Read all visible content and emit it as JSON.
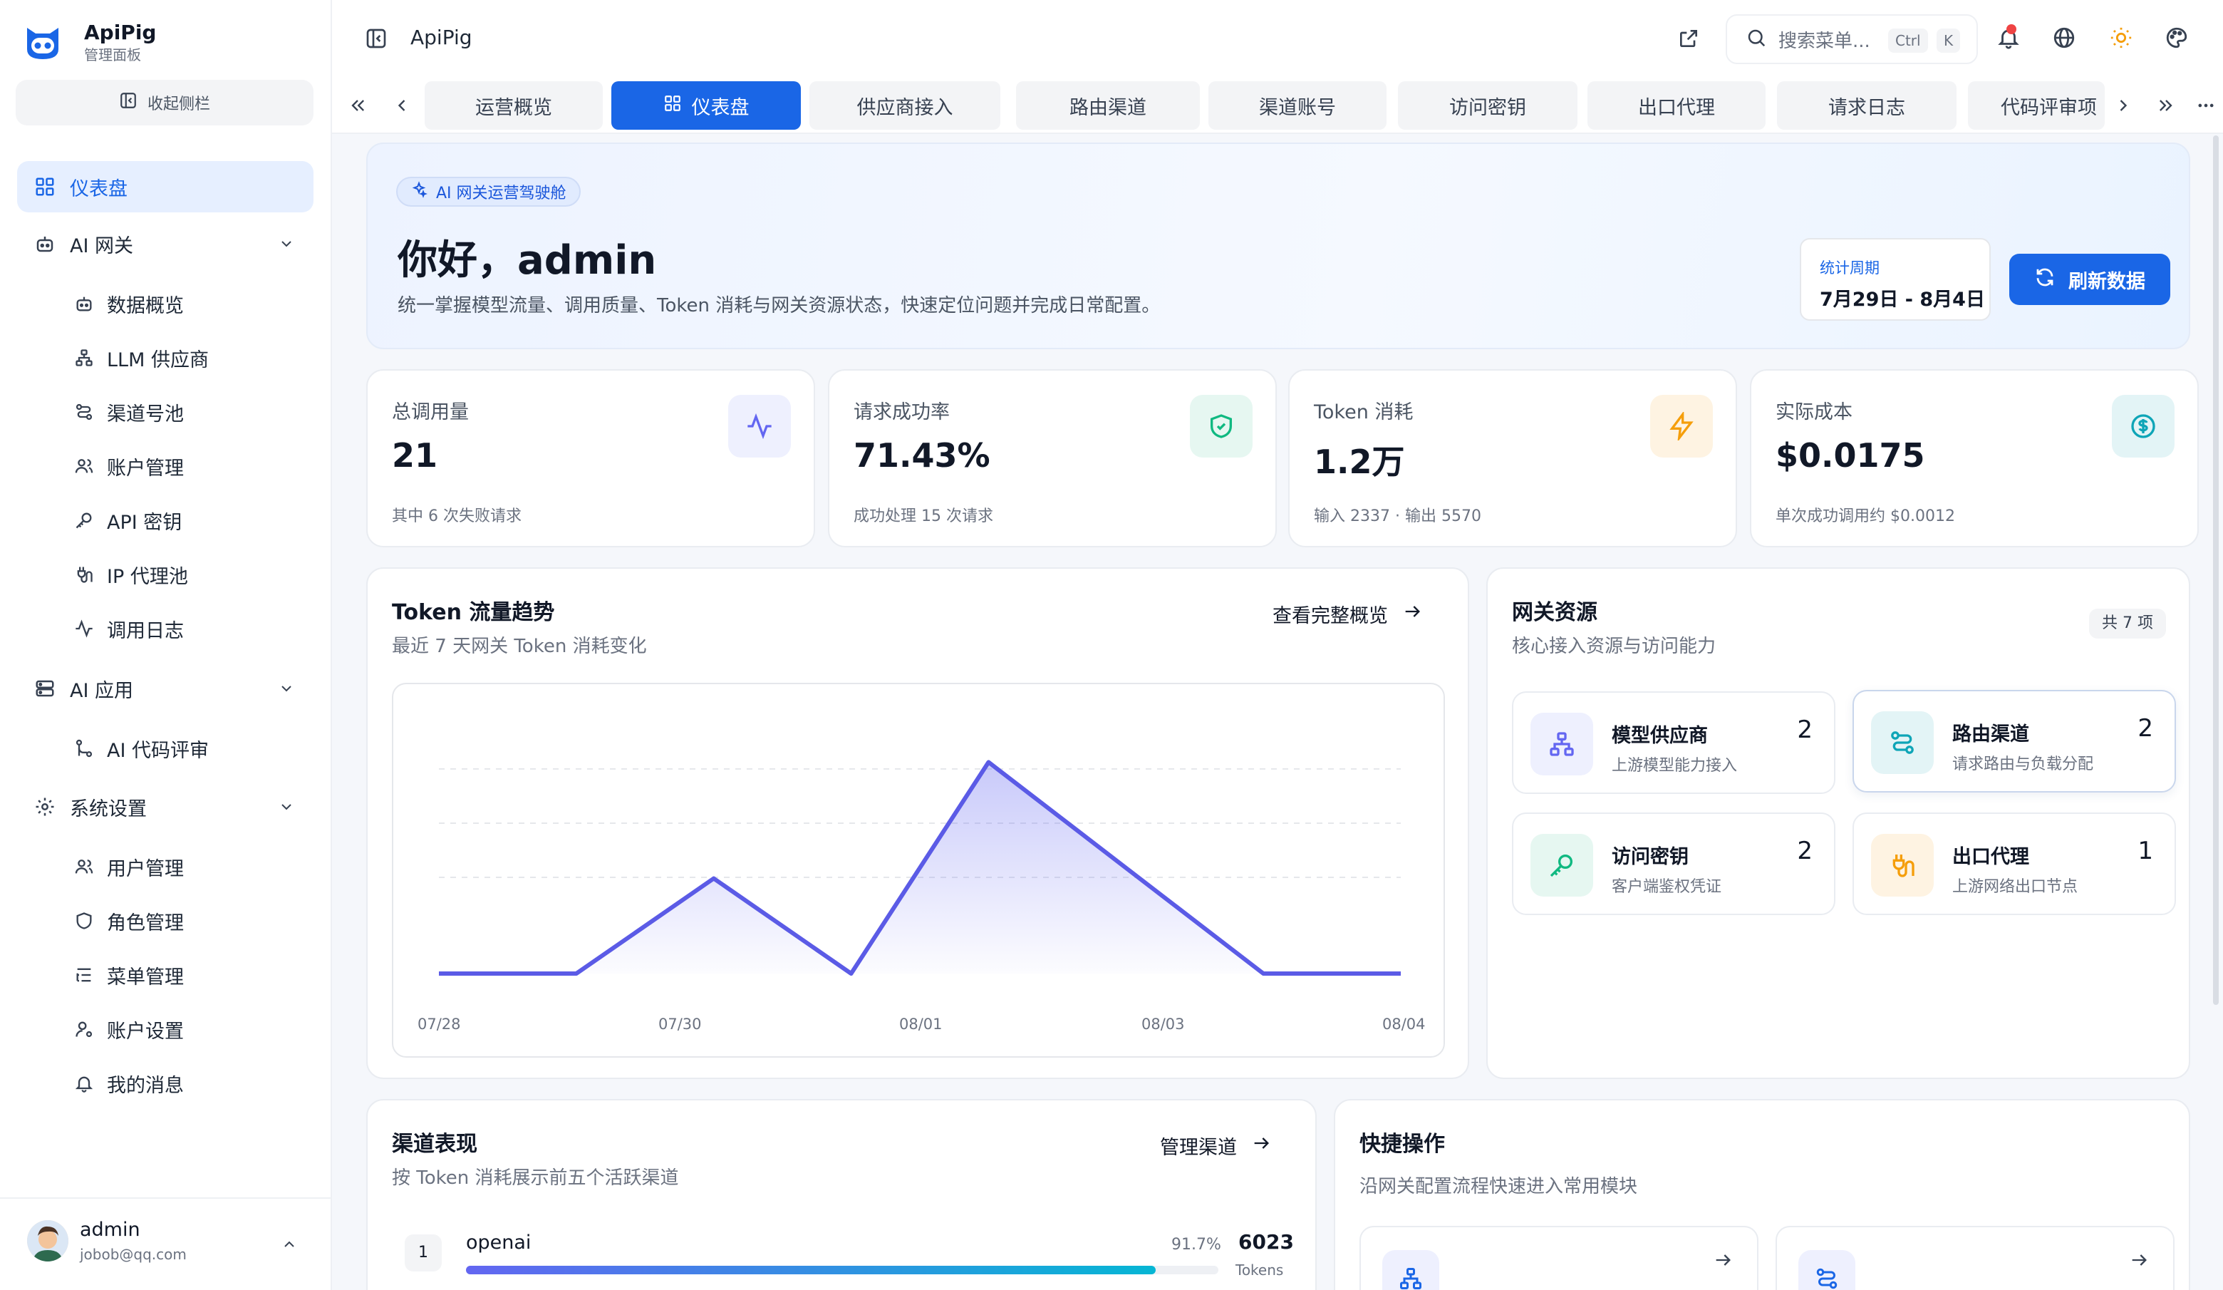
{
  "brand": {
    "name": "ApiPig",
    "subtitle": "管理面板"
  },
  "sidebar": {
    "collapse_label": "收起侧栏",
    "items": [
      {
        "label": "仪表盘",
        "icon": "dashboard-icon",
        "active": true
      },
      {
        "label": "AI 网关",
        "icon": "robot-icon",
        "group": true
      },
      {
        "label": "数据概览",
        "icon": "robot-icon"
      },
      {
        "label": "LLM 供应商",
        "icon": "network-icon"
      },
      {
        "label": "渠道号池",
        "icon": "route-icon"
      },
      {
        "label": "账户管理",
        "icon": "users-icon"
      },
      {
        "label": "API 密钥",
        "icon": "key-icon"
      },
      {
        "label": "IP 代理池",
        "icon": "plug-icon"
      },
      {
        "label": "调用日志",
        "icon": "activity-icon"
      },
      {
        "label": "AI 应用",
        "icon": "server-icon",
        "group": true
      },
      {
        "label": "AI 代码评审",
        "icon": "git-icon"
      },
      {
        "label": "系统设置",
        "icon": "gear-icon",
        "group": true
      },
      {
        "label": "用户管理",
        "icon": "users-icon"
      },
      {
        "label": "角色管理",
        "icon": "shield-icon"
      },
      {
        "label": "菜单管理",
        "icon": "list-icon"
      },
      {
        "label": "账户设置",
        "icon": "user-gear-icon"
      },
      {
        "label": "我的消息",
        "icon": "bell-icon"
      }
    ]
  },
  "user": {
    "name": "admin",
    "email": "jobob@qq.com"
  },
  "topbar": {
    "title": "ApiPig",
    "search_placeholder": "搜索菜单...",
    "kbd_ctrl": "Ctrl",
    "kbd_k": "K"
  },
  "tabs": [
    {
      "label": "运营概览",
      "active": false
    },
    {
      "label": "仪表盘",
      "active": true
    },
    {
      "label": "供应商接入",
      "active": false
    },
    {
      "label": "路由渠道",
      "active": false
    },
    {
      "label": "渠道账号",
      "active": false
    },
    {
      "label": "访问密钥",
      "active": false
    },
    {
      "label": "出口代理",
      "active": false
    },
    {
      "label": "请求日志",
      "active": false
    },
    {
      "label": "代码评审项",
      "active": false
    }
  ],
  "hero": {
    "badge": "AI 网关运营驾驶舱",
    "title": "你好，admin",
    "desc": "统一掌握模型流量、调用质量、Token 消耗与网关资源状态，快速定位问题并完成日常配置。",
    "period_label": "统计周期",
    "period_value": "7月29日 - 8月4日",
    "refresh_label": "刷新数据"
  },
  "stats": [
    {
      "label": "总调用量",
      "value": "21",
      "sub": "其中 6 次失败请求",
      "icon": "activity-icon",
      "color": "#6366f1",
      "bg": "#eef0fe"
    },
    {
      "label": "请求成功率",
      "value": "71.43%",
      "sub": "成功处理 15 次请求",
      "icon": "shield-check-icon",
      "color": "#10b981",
      "bg": "#e6f7f1"
    },
    {
      "label": "Token 消耗",
      "value": "1.2万",
      "sub": "输入 2337 · 输出 5570",
      "icon": "bolt-icon",
      "color": "#f59e0b",
      "bg": "#fef3e2"
    },
    {
      "label": "实际成本",
      "value": "$0.0175",
      "sub": "单次成功调用约 $0.0012",
      "icon": "dollar-icon",
      "color": "#0ea5b7",
      "bg": "#e3f4f6"
    }
  ],
  "trend": {
    "title": "Token 流量趋势",
    "subtitle": "最近 7 天网关 Token 消耗变化",
    "link": "查看完整概览"
  },
  "chart_data": {
    "type": "area",
    "x": [
      "07/28",
      "07/29",
      "07/30",
      "07/31",
      "08/01",
      "08/02",
      "08/03",
      "08/04"
    ],
    "tick_labels": [
      "07/28",
      "07/30",
      "08/01",
      "08/03",
      "08/04"
    ],
    "values": [
      0,
      0,
      2700,
      0,
      6000,
      3000,
      0,
      0
    ],
    "ylim": [
      0,
      7000
    ],
    "grid": true,
    "color": "#5b5be6"
  },
  "resources": {
    "title": "网关资源",
    "subtitle": "核心接入资源与访问能力",
    "count_badge": "共 7 项",
    "items": [
      {
        "name": "模型供应商",
        "desc": "上游模型能力接入",
        "count": "2",
        "icon": "network-icon",
        "color": "#6366f1",
        "bg": "#eef0fe"
      },
      {
        "name": "路由渠道",
        "desc": "请求路由与负载分配",
        "count": "2",
        "icon": "route-icon",
        "color": "#0ea5b7",
        "bg": "#e3f4f6"
      },
      {
        "name": "访问密钥",
        "desc": "客户端鉴权凭证",
        "count": "2",
        "icon": "key-icon",
        "color": "#10b981",
        "bg": "#e6f7f1"
      },
      {
        "name": "出口代理",
        "desc": "上游网络出口节点",
        "count": "1",
        "icon": "plug-icon",
        "color": "#f59e0b",
        "bg": "#fef3e2"
      }
    ]
  },
  "channels": {
    "title": "渠道表现",
    "subtitle": "按 Token 消耗展示前五个活跃渠道",
    "link": "管理渠道",
    "rows": [
      {
        "rank": "1",
        "name": "openai",
        "percent": "91.7%",
        "progress": 0.917,
        "tokens": "6023",
        "unit": "Tokens"
      }
    ]
  },
  "quick": {
    "title": "快捷操作",
    "subtitle": "沿网关配置流程快速进入常用模块"
  }
}
